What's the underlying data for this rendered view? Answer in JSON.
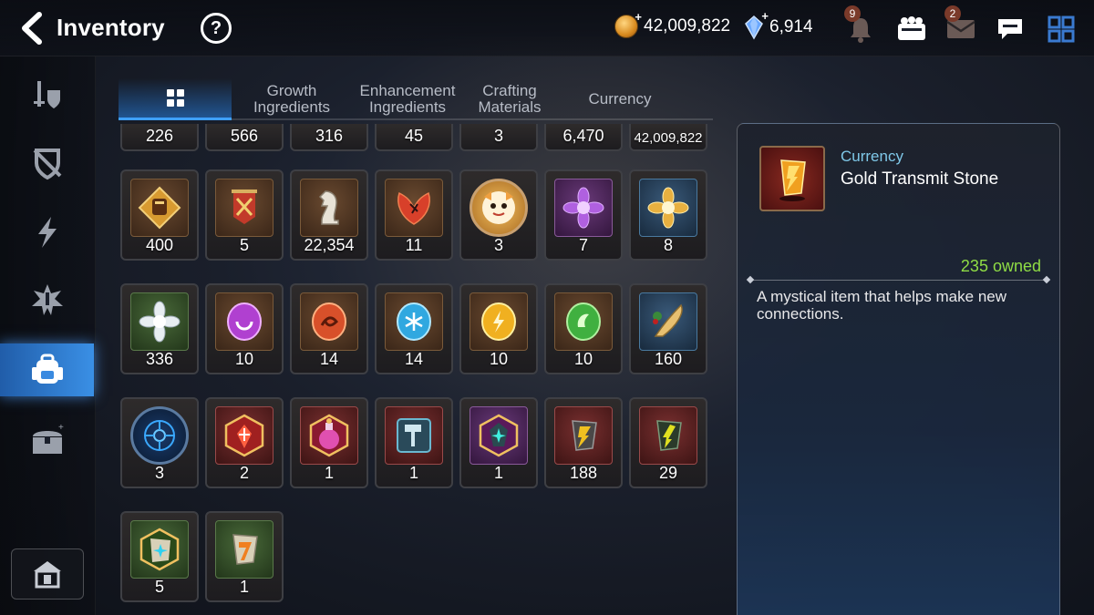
{
  "header": {
    "title": "Inventory",
    "help_label": "?",
    "gold_value": "42,009,822",
    "crystal_value": "6,914",
    "notifications_badge": "9",
    "mail_badge": "2"
  },
  "sidebar": {
    "items": [
      {
        "icon": "equipment-icon"
      },
      {
        "icon": "artifact-icon"
      },
      {
        "icon": "lightning-icon"
      },
      {
        "icon": "exclusive-equipment-icon"
      },
      {
        "icon": "backpack-icon",
        "active": true
      },
      {
        "icon": "treasure-chest-icon"
      }
    ],
    "bottom_icon": "house-storage-icon"
  },
  "tabs": [
    {
      "label": "",
      "icon": "grid-icon",
      "active": true
    },
    {
      "label": "Growth Ingredients"
    },
    {
      "label": "Enhancement Ingredients"
    },
    {
      "label": "Crafting Materials"
    },
    {
      "label": "Currency"
    }
  ],
  "items": {
    "row0": [
      "226",
      "566",
      "316",
      "45",
      "3",
      "6,470",
      "42,009,822"
    ],
    "row1": [
      {
        "icon": "fist-emblem-icon",
        "count": "400"
      },
      {
        "icon": "banner-swords-icon",
        "count": "5"
      },
      {
        "icon": "chess-knight-icon",
        "count": "22,354"
      },
      {
        "icon": "red-leaf-icon",
        "count": "11"
      },
      {
        "icon": "chibi-mascot-icon",
        "count": "3"
      },
      {
        "icon": "purple-flower-icon",
        "count": "7"
      },
      {
        "icon": "gold-flower-icon",
        "count": "8"
      }
    ],
    "row2": [
      {
        "icon": "white-flower-icon",
        "count": "336"
      },
      {
        "icon": "purple-rune-icon",
        "count": "10"
      },
      {
        "icon": "red-rune-icon",
        "count": "14"
      },
      {
        "icon": "blue-rune-icon",
        "count": "14"
      },
      {
        "icon": "yellow-rune-icon",
        "count": "10"
      },
      {
        "icon": "green-rune-icon",
        "count": "10"
      },
      {
        "icon": "fish-herb-icon",
        "count": "160"
      }
    ],
    "row3": [
      {
        "icon": "blue-circuit-icon",
        "count": "3"
      },
      {
        "icon": "red-crystal-icon",
        "count": "2"
      },
      {
        "icon": "pink-potion-icon",
        "count": "1"
      },
      {
        "icon": "hammer-stone-icon",
        "count": "1"
      },
      {
        "icon": "teal-star-stone-icon",
        "count": "1"
      },
      {
        "icon": "gold-transmit-stone-icon",
        "count": "188"
      },
      {
        "icon": "green-transmit-stone-icon",
        "count": "29"
      }
    ],
    "row4": [
      {
        "icon": "cyan-star-stone-icon",
        "count": "5"
      },
      {
        "icon": "orange-transmit-stone-icon",
        "count": "1"
      }
    ]
  },
  "detail": {
    "category": "Currency",
    "name": "Gold Transmit Stone",
    "owned": "235 owned",
    "description": "A mystical item that helps make new connections.",
    "icon": "gold-transmit-stone-icon"
  },
  "colors": {
    "accent_blue": "#3fa0ff",
    "owned_green": "#8fdc45",
    "category_cyan": "#7fc8e8"
  }
}
